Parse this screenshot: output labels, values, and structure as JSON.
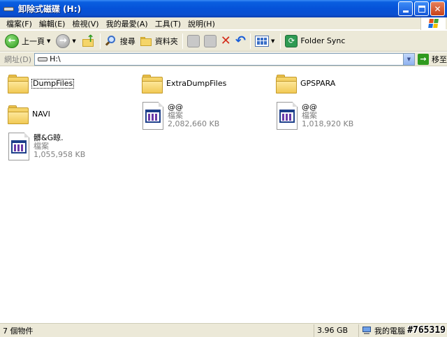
{
  "window": {
    "title": "卸除式磁碟 (H:)"
  },
  "menu": [
    "檔案(F)",
    "編輯(E)",
    "檢視(V)",
    "我的最愛(A)",
    "工具(T)",
    "說明(H)"
  ],
  "toolbar": {
    "back_label": "上一頁",
    "search_label": "搜尋",
    "folders_label": "資料夾",
    "folder_sync_label": "Folder Sync"
  },
  "address": {
    "label": "網址(D)",
    "value": "H:\\",
    "go_label": "移至"
  },
  "items": [
    {
      "type": "folder",
      "name": "DumpFiles"
    },
    {
      "type": "folder",
      "name": "ExtraDumpFiles"
    },
    {
      "type": "folder",
      "name": "GPSPARA"
    },
    {
      "type": "folder",
      "name": "NAVI"
    },
    {
      "type": "file",
      "name": "@@",
      "kind": "檔案",
      "size": "2,082,660 KB"
    },
    {
      "type": "file",
      "name": "@@",
      "kind": "檔案",
      "size": "1,018,920 KB"
    },
    {
      "type": "file",
      "name": "髒&G晾.",
      "kind": "檔案",
      "size": "1,055,958 KB"
    }
  ],
  "status": {
    "objects": "7 個物件",
    "size": "3.96 GB",
    "location": "我的電腦"
  },
  "watermark": "#765319"
}
